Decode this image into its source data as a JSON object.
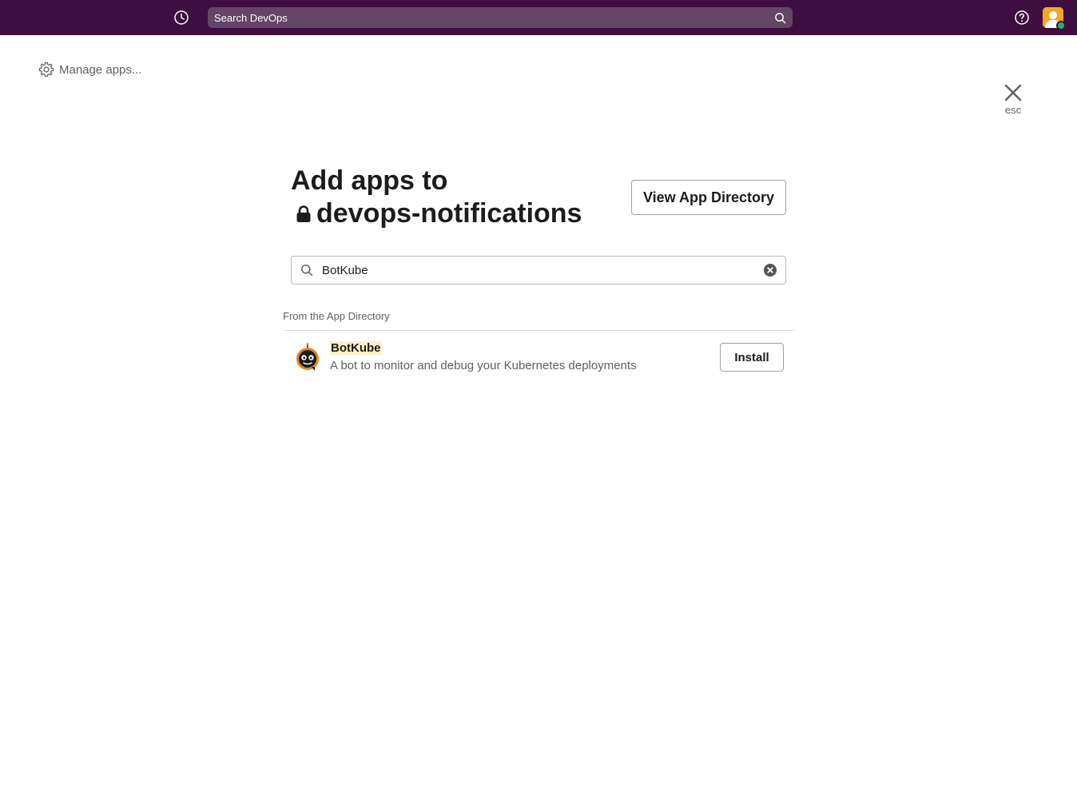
{
  "topbar": {
    "history_icon": "clock-icon",
    "search_placeholder": "Search DevOps",
    "search_icon": "search-icon",
    "help_icon": "help-circle-icon",
    "avatar_icon": "user-avatar",
    "presence": "active",
    "background_color": "#3f0e40",
    "presence_color": "#2bac76"
  },
  "manage_apps": {
    "icon": "gear-icon",
    "label": "Manage apps..."
  },
  "close": {
    "icon": "close-icon",
    "label": "esc"
  },
  "header": {
    "title_line1": "Add apps to",
    "channel_icon": "lock-icon",
    "channel_name": "devops-notifications",
    "view_directory_label": "View App Directory"
  },
  "app_search": {
    "icon": "search-icon",
    "value": "BotKube",
    "clear_icon": "clear-circle-icon"
  },
  "results": {
    "section_label": "From the App Directory",
    "items": [
      {
        "name": "BotKube",
        "description": "A bot to monitor and debug your Kubernetes deployments",
        "icon": "botkube-logo",
        "action_label": "Install",
        "highlight_color": "#fdf0c4"
      }
    ]
  }
}
